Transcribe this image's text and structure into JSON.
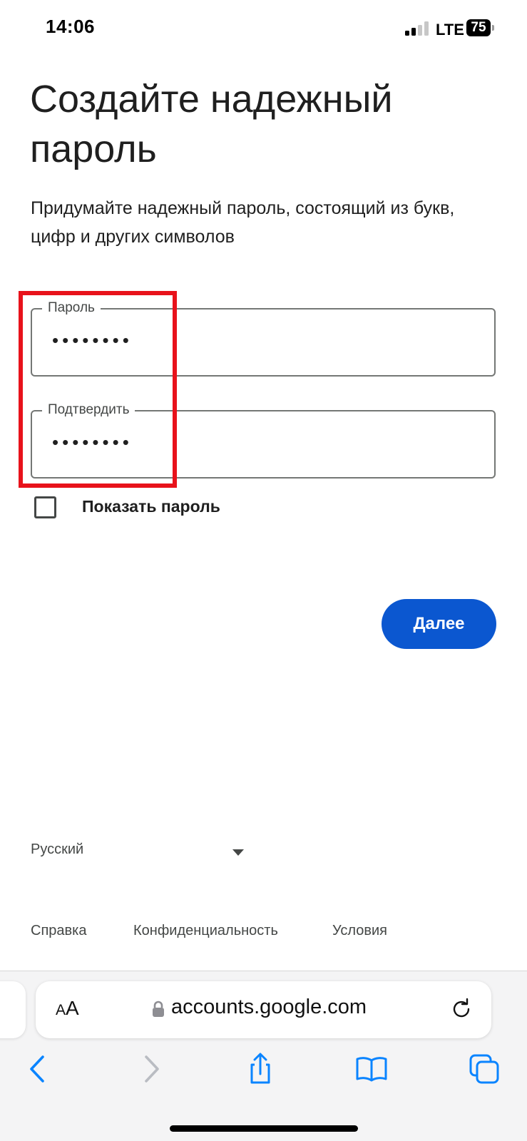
{
  "status_bar": {
    "time": "14:06",
    "network": "LTE",
    "battery": "75"
  },
  "page": {
    "title": "Создайте надежный пароль",
    "subtitle": "Придумайте надежный пароль, состоящий из букв, цифр и других символов"
  },
  "form": {
    "password": {
      "label": "Пароль",
      "value": "••••••••"
    },
    "confirm": {
      "label": "Подтвердить",
      "value": "••••••••"
    },
    "show_password": {
      "label": "Показать пароль",
      "checked": false
    },
    "next_label": "Далее"
  },
  "footer": {
    "language": "Русский",
    "links": [
      "Справка",
      "Конфиденциальность",
      "Условия"
    ]
  },
  "browser": {
    "text_size_small": "A",
    "text_size_large": "A",
    "url": "accounts.google.com",
    "toolbar_icons": [
      "back-icon",
      "forward-icon",
      "share-icon",
      "bookmarks-icon",
      "tabs-icon"
    ]
  },
  "colors": {
    "accent": "#0b57d0",
    "annotation": "#e8121b",
    "browser_icons": "#0a84ff"
  }
}
